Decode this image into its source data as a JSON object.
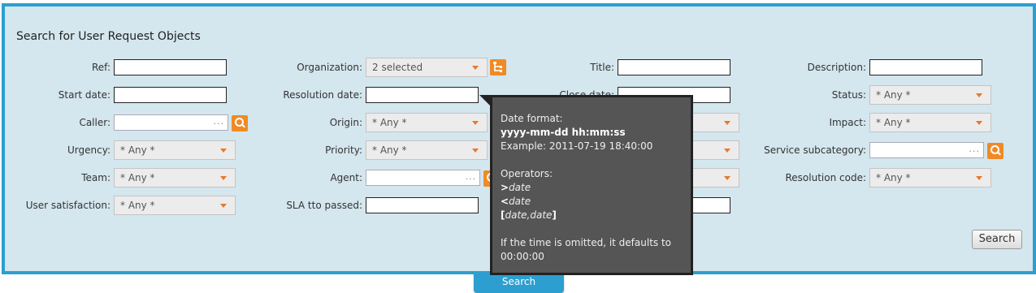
{
  "panel": {
    "title": "Search for User Request Objects"
  },
  "fields": {
    "ref": {
      "label": "Ref:",
      "value": ""
    },
    "organization": {
      "label": "Organization:",
      "value": "2 selected"
    },
    "title": {
      "label": "Title:",
      "value": ""
    },
    "description": {
      "label": "Description:",
      "value": ""
    },
    "start_date": {
      "label": "Start date:",
      "value": ""
    },
    "resolution_date": {
      "label": "Resolution date:",
      "value": ""
    },
    "close_date": {
      "label": "Close date:",
      "value": ""
    },
    "status": {
      "label": "Status:",
      "value": "* Any *"
    },
    "caller": {
      "label": "Caller:",
      "value": ""
    },
    "origin": {
      "label": "Origin:",
      "value": "* Any *"
    },
    "impact": {
      "label": "Impact:",
      "value": "* Any *"
    },
    "urgency": {
      "label": "Urgency:",
      "value": "* Any *"
    },
    "priority": {
      "label": "Priority:",
      "value": "* Any *"
    },
    "service_subcategory": {
      "label": "Service subcategory:",
      "value": ""
    },
    "team": {
      "label": "Team:",
      "value": "* Any *"
    },
    "agent": {
      "label": "Agent:",
      "value": ""
    },
    "resolution_code": {
      "label": "Resolution code:",
      "value": "* Any *"
    },
    "user_satisfaction": {
      "label": "User satisfaction:",
      "value": "* Any *"
    },
    "sla_tto_passed": {
      "label": "SLA tto passed:",
      "value": ""
    }
  },
  "autocomplete_dots": "...",
  "buttons": {
    "search": "Search",
    "bottom_tab": "Search"
  },
  "tooltip": {
    "heading": "Date format:",
    "format": "yyyy-mm-dd hh:mm:ss",
    "example": "Example: 2011-07-19 18:40:00",
    "operators_heading": "Operators:",
    "op_gt_symbol": ">",
    "op_lt_symbol": "<",
    "op_date": "date",
    "range_open": "[",
    "range_body": "date,date",
    "range_close": "]",
    "note": "If the time is omitted, it defaults to 00:00:00"
  },
  "colors": {
    "panel_border": "#2c9fd0",
    "panel_bg": "#d4e6ee",
    "accent": "#f08a24",
    "tooltip_bg": "#555555"
  },
  "icons": [
    "search-icon",
    "tree-icon",
    "chevron-down-icon"
  ]
}
